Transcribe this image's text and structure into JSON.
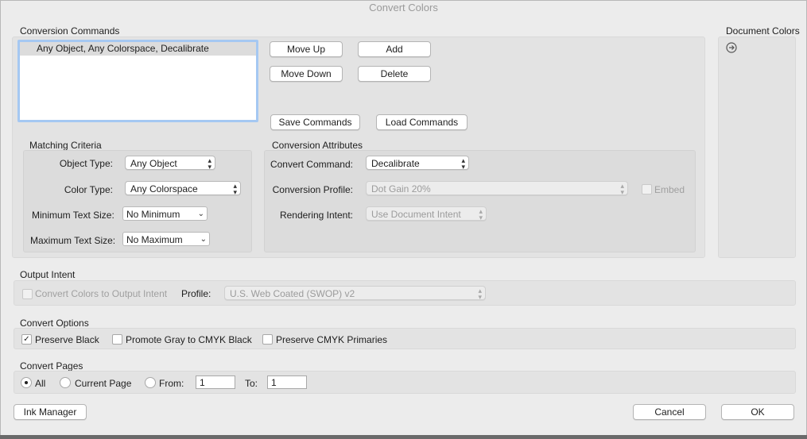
{
  "window": {
    "title": "Convert Colors"
  },
  "conversion_commands": {
    "label": "Conversion Commands",
    "items": [
      "Any Object, Any Colorspace, Decalibrate"
    ],
    "buttons": {
      "move_up": "Move Up",
      "add": "Add",
      "move_down": "Move Down",
      "delete": "Delete",
      "save_commands": "Save Commands",
      "load_commands": "Load Commands"
    }
  },
  "document_colors": {
    "label": "Document Colors",
    "icon": "arrow-right-circle-icon"
  },
  "matching_criteria": {
    "label": "Matching Criteria",
    "object_type": {
      "label": "Object Type:",
      "value": "Any Object"
    },
    "color_type": {
      "label": "Color Type:",
      "value": "Any Colorspace"
    },
    "min_text_size": {
      "label": "Minimum Text Size:",
      "value": "No Minimum"
    },
    "max_text_size": {
      "label": "Maximum Text Size:",
      "value": "No Maximum"
    }
  },
  "conversion_attributes": {
    "label": "Conversion Attributes",
    "convert_command": {
      "label": "Convert Command:",
      "value": "Decalibrate"
    },
    "conversion_profile": {
      "label": "Conversion Profile:",
      "value": "Dot Gain 20%",
      "enabled": false
    },
    "embed": {
      "label": "Embed",
      "checked": false,
      "enabled": false
    },
    "rendering_intent": {
      "label": "Rendering Intent:",
      "value": "Use Document Intent",
      "enabled": false
    }
  },
  "output_intent": {
    "label": "Output Intent",
    "convert_to_output": {
      "label": "Convert Colors to Output Intent",
      "checked": false,
      "enabled": false
    },
    "profile": {
      "label": "Profile:",
      "value": "U.S. Web Coated (SWOP) v2",
      "enabled": false
    }
  },
  "convert_options": {
    "label": "Convert Options",
    "preserve_black": {
      "label": "Preserve Black",
      "checked": true
    },
    "promote_gray": {
      "label": "Promote Gray to CMYK Black",
      "checked": false
    },
    "preserve_cmyk": {
      "label": "Preserve CMYK Primaries",
      "checked": false
    }
  },
  "convert_pages": {
    "label": "Convert Pages",
    "all": {
      "label": "All",
      "selected": true
    },
    "current_page": {
      "label": "Current Page",
      "selected": false
    },
    "from": {
      "label": "From:",
      "value": "1",
      "selected": false
    },
    "to": {
      "label": "To:",
      "value": "1"
    }
  },
  "footer": {
    "ink_manager": "Ink Manager",
    "cancel": "Cancel",
    "ok": "OK"
  },
  "colors": {
    "accent_focus": "#a5c8f2",
    "window_bg": "#ececec"
  }
}
